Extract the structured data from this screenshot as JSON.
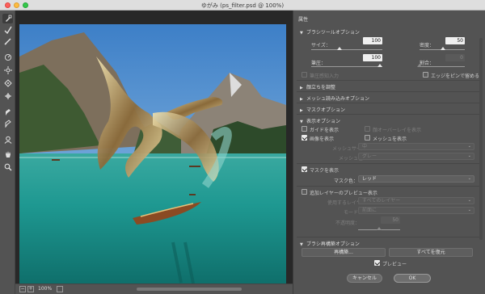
{
  "window": {
    "title": "ゆがみ (ps_filter.psd @ 100%)"
  },
  "toolbar": {
    "tools": [
      {
        "name": "forward-warp-tool",
        "glyph": "☞"
      },
      {
        "name": "reconstruct-tool",
        "glyph": "✓"
      },
      {
        "name": "smooth-tool",
        "glyph": "✎"
      },
      {
        "name": "twirl-clockwise-tool",
        "glyph": "◎"
      },
      {
        "name": "pucker-tool",
        "glyph": "✺"
      },
      {
        "name": "bloat-tool",
        "glyph": "◈"
      },
      {
        "name": "push-left-tool",
        "glyph": "⇔"
      },
      {
        "name": "freeze-mask-tool",
        "glyph": "✍"
      },
      {
        "name": "thaw-mask-tool",
        "glyph": "✐"
      },
      {
        "name": "face-tool",
        "glyph": "☺"
      },
      {
        "name": "hand-tool",
        "glyph": "✋"
      },
      {
        "name": "zoom-tool",
        "glyph": "🔍"
      }
    ]
  },
  "statusbar": {
    "zoom_value": "100%",
    "minus": "−",
    "plus": "+"
  },
  "panel": {
    "title": "属性",
    "brush_tool_options": {
      "header": "ブラシツールオプション",
      "size_label": "サイズ：",
      "size_value": "100",
      "density_label": "密度：",
      "density_value": "50",
      "pressure_label": "筆圧：",
      "pressure_value": "100",
      "rate_label": "割合：",
      "rate_value": "0",
      "stylus_label": "筆圧感知入力",
      "pin_edges_label": "エッジをピンで留める"
    },
    "face_aware": {
      "header": "顔立ちを調整"
    },
    "mesh_load": {
      "header": "メッシュ読み込みオプション"
    },
    "mask_options": {
      "header": "マスクオプション"
    },
    "view_options": {
      "header": "表示オプション",
      "show_guides_label": "ガイドを表示",
      "show_face_overlay_label": "顔オーバーレイを表示",
      "show_image_label": "画像を表示",
      "show_mesh_label": "メッシュを表示",
      "mesh_size_label": "メッシュサイズ：",
      "mesh_size_value": "中",
      "mesh_color_label": "メッシュ色：",
      "mesh_color_value": "グレー",
      "show_mask_label": "マスクを表示",
      "mask_color_label": "マスク色：",
      "mask_color_value": "レッド",
      "show_backdrop_label": "追加レイヤーのプレビュー表示",
      "use_label": "使用するレイヤー：",
      "use_value": "すべてのレイヤー",
      "mode_label": "モード：",
      "mode_value": "前面に",
      "opacity_label": "不透明度：",
      "opacity_value": "50"
    },
    "brush_reconstruct": {
      "header": "ブラシ再構築オプション",
      "reconstruct_button": "再構築...",
      "restore_all_button": "すべてを復元"
    },
    "preview_label": "プレビュー",
    "cancel_button": "キャンセル",
    "ok_button": "OK"
  },
  "colors": {
    "chrome": "#535353",
    "canvas_bg": "#282828",
    "water": "#1f9c9a",
    "sky": "#4a90d0"
  }
}
